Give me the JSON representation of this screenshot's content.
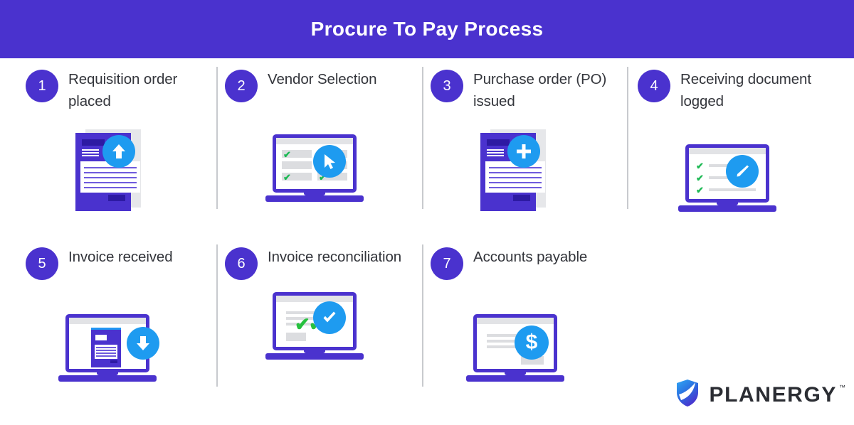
{
  "header": {
    "title": "Procure To Pay Process",
    "background_color": "#4a32ce",
    "text_color": "#ffffff"
  },
  "theme": {
    "purple": "#4a32ce",
    "blue_accent": "#1e9bf0",
    "green_check": "#1db954",
    "text": "#33353b",
    "divider": "#c8cace",
    "page_background": "#ffffff"
  },
  "steps": [
    {
      "number": "1",
      "label": "Requisition order placed",
      "icon": "document-upload-icon",
      "accent_icon": "arrow-up-icon",
      "illustration": "purple-document"
    },
    {
      "number": "2",
      "label": "Vendor Selection",
      "icon": "laptop-checklist-cursor-icon",
      "accent_icon": "cursor-arrow-icon",
      "illustration": "laptop-grid-checklist"
    },
    {
      "number": "3",
      "label": "Purchase order (PO) issued",
      "icon": "document-add-icon",
      "accent_icon": "plus-icon",
      "illustration": "purple-document"
    },
    {
      "number": "4",
      "label": "Receiving document logged",
      "icon": "laptop-edit-icon",
      "accent_icon": "pencil-icon",
      "illustration": "laptop-checklist-lines"
    },
    {
      "number": "5",
      "label": "Invoice received",
      "icon": "laptop-download-icon",
      "accent_icon": "arrow-down-icon",
      "illustration": "laptop-with-document"
    },
    {
      "number": "6",
      "label": "Invoice reconciliation",
      "icon": "laptop-verified-icon",
      "accent_icon": "check-icon",
      "illustration": "laptop-triple-check"
    },
    {
      "number": "7",
      "label": "Accounts payable",
      "icon": "laptop-payment-icon",
      "accent_icon": "dollar-icon",
      "illustration": "laptop-invoice-lines"
    }
  ],
  "logo": {
    "name": "PLANERGY",
    "trademark": "™",
    "mark": "shield-icon"
  }
}
